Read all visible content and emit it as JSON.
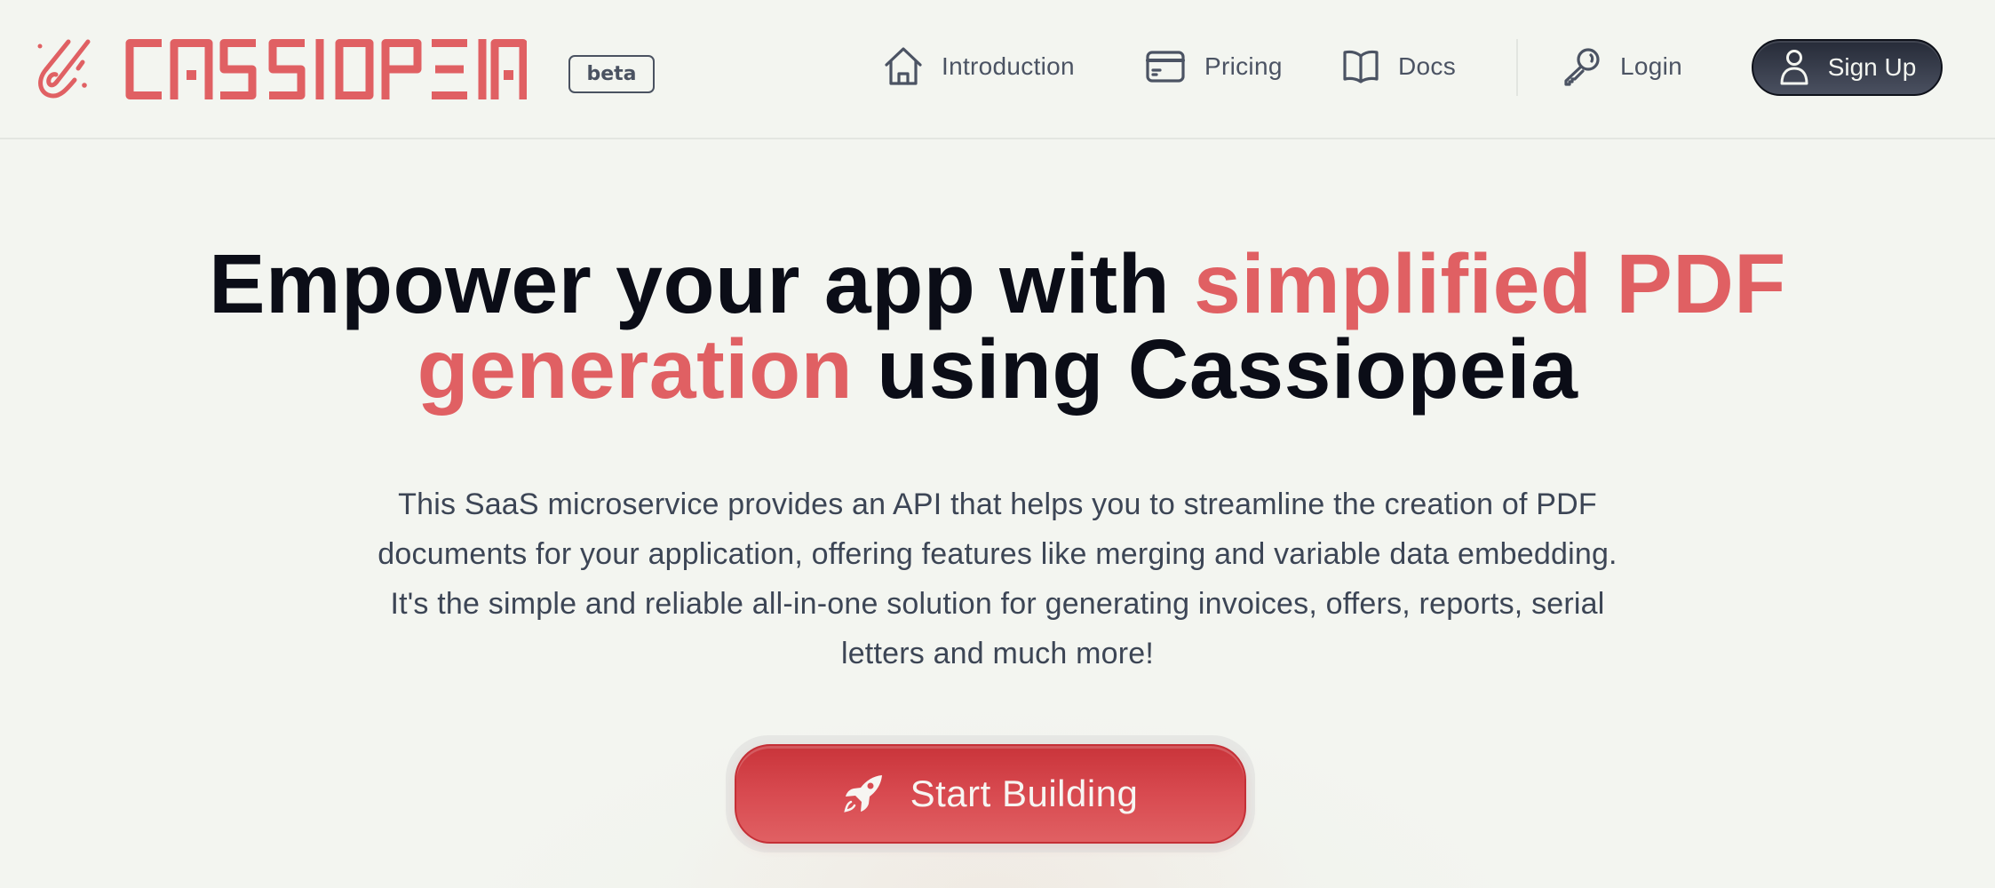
{
  "brand": {
    "name": "CASSIOPEIA",
    "badge": "beta",
    "accent_color": "#e06063",
    "logo_icon": "comet-icon"
  },
  "nav": {
    "items": [
      {
        "label": "Introduction",
        "icon": "home-icon"
      },
      {
        "label": "Pricing",
        "icon": "credit-card-icon"
      },
      {
        "label": "Docs",
        "icon": "book-icon"
      },
      {
        "label": "Login",
        "icon": "key-icon"
      }
    ],
    "signup": {
      "label": "Sign Up",
      "icon": "user-icon",
      "bg_color": "#2f3442"
    }
  },
  "hero": {
    "headline": {
      "part1": "Empower your app with ",
      "accent1": "simplified PDF",
      "accent2": "generation",
      "part2": " using Cassiopeia"
    },
    "description": "This SaaS microservice provides an API that helps you to streamline the creation of PDF documents for your application, offering features like merging and variable data embedding. It's the simple and reliable all-in-one solution for generating invoices, offers, reports, serial letters and much more!",
    "cta": {
      "label": "Start Building",
      "icon": "rocket-icon",
      "color": "#d84a50"
    }
  }
}
